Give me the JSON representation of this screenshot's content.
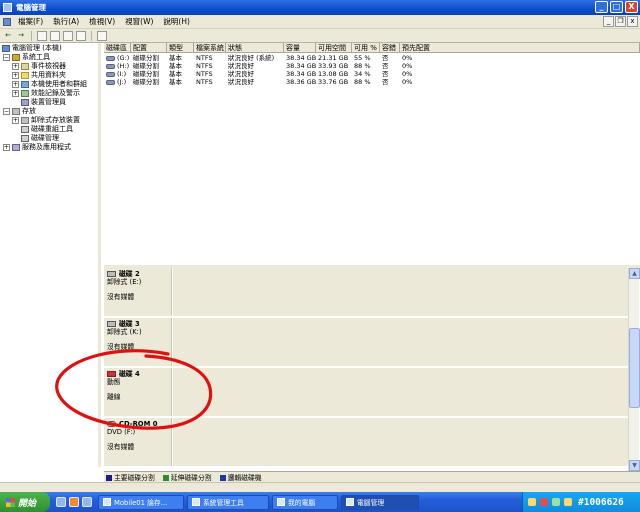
{
  "window": {
    "title": "電腦管理",
    "controls": {
      "minimize": "_",
      "maximize": "□",
      "close": "X"
    }
  },
  "menu": {
    "items": [
      "檔案(F)",
      "執行(A)",
      "檢視(V)",
      "視窗(W)",
      "說明(H)"
    ],
    "doc_controls": {
      "minimize": "_",
      "restore": "❐",
      "close": "x"
    }
  },
  "toolbar": {
    "back": "←",
    "forward": "→"
  },
  "tree": {
    "root": "電腦管理 (本機)",
    "system_tools": "系統工具",
    "event_viewer": "事件檢視器",
    "shared_folders": "共用資料夾",
    "local_users": "本機使用者和群組",
    "perf_logs": "效能記錄及警示",
    "device_manager": "裝置管理員",
    "storage": "存放",
    "removable": "卸除式存放裝置",
    "defrag": "磁碟重組工具",
    "disk_mgmt": "磁碟管理",
    "services": "服務及應用程式"
  },
  "volumes": {
    "headers": [
      "磁碟區",
      "配置",
      "類型",
      "檔案系統",
      "狀態",
      "容量",
      "可用空間",
      "可用 %",
      "容錯",
      "預先配置"
    ],
    "rows": [
      [
        "(G:)",
        "磁碟分割",
        "基本",
        "NTFS",
        "狀況良好 (系統)",
        "38.34 GB",
        "21.31 GB",
        "55 %",
        "否",
        "0%"
      ],
      [
        "(H:)",
        "磁碟分割",
        "基本",
        "NTFS",
        "狀況良好",
        "38.34 GB",
        "33.93 GB",
        "88 %",
        "否",
        "0%"
      ],
      [
        "(I:)",
        "磁碟分割",
        "基本",
        "NTFS",
        "狀況良好",
        "38.34 GB",
        "13.08 GB",
        "34 %",
        "否",
        "0%"
      ],
      [
        "(J:)",
        "磁碟分割",
        "基本",
        "NTFS",
        "狀況良好",
        "38.36 GB",
        "33.76 GB",
        "88 %",
        "否",
        "0%"
      ]
    ]
  },
  "disks": [
    {
      "name": "磁碟 2",
      "type": "卸除式 (E:)",
      "status": "沒有媒體",
      "icon": "disk-icon"
    },
    {
      "name": "磁碟 3",
      "type": "卸除式 (K:)",
      "status": "沒有媒體",
      "icon": "disk-icon"
    },
    {
      "name": "磁碟 4",
      "type": "動態",
      "status": "離線",
      "icon": "disk-offline-icon"
    },
    {
      "name": "CD-ROM 0",
      "type": "DVD (F:)",
      "status": "沒有媒體",
      "icon": "cdrom-icon"
    }
  ],
  "legend": [
    {
      "label": "主要磁碟分割",
      "color": "#1a1a8c"
    },
    {
      "label": "延伸磁碟分割",
      "color": "#2e8b2e"
    },
    {
      "label": "邏輯磁碟機",
      "color": "#1a3aa0"
    }
  ],
  "taskbar": {
    "start": "開始",
    "tasks": [
      "Mobile01 論存...",
      "系統管理工具",
      "我的電腦",
      "電腦管理"
    ],
    "watermark": "#1006626"
  },
  "colors": {
    "titlebar": "#0a4fd0",
    "face": "#ece9d8",
    "annotation": "#e01010"
  }
}
